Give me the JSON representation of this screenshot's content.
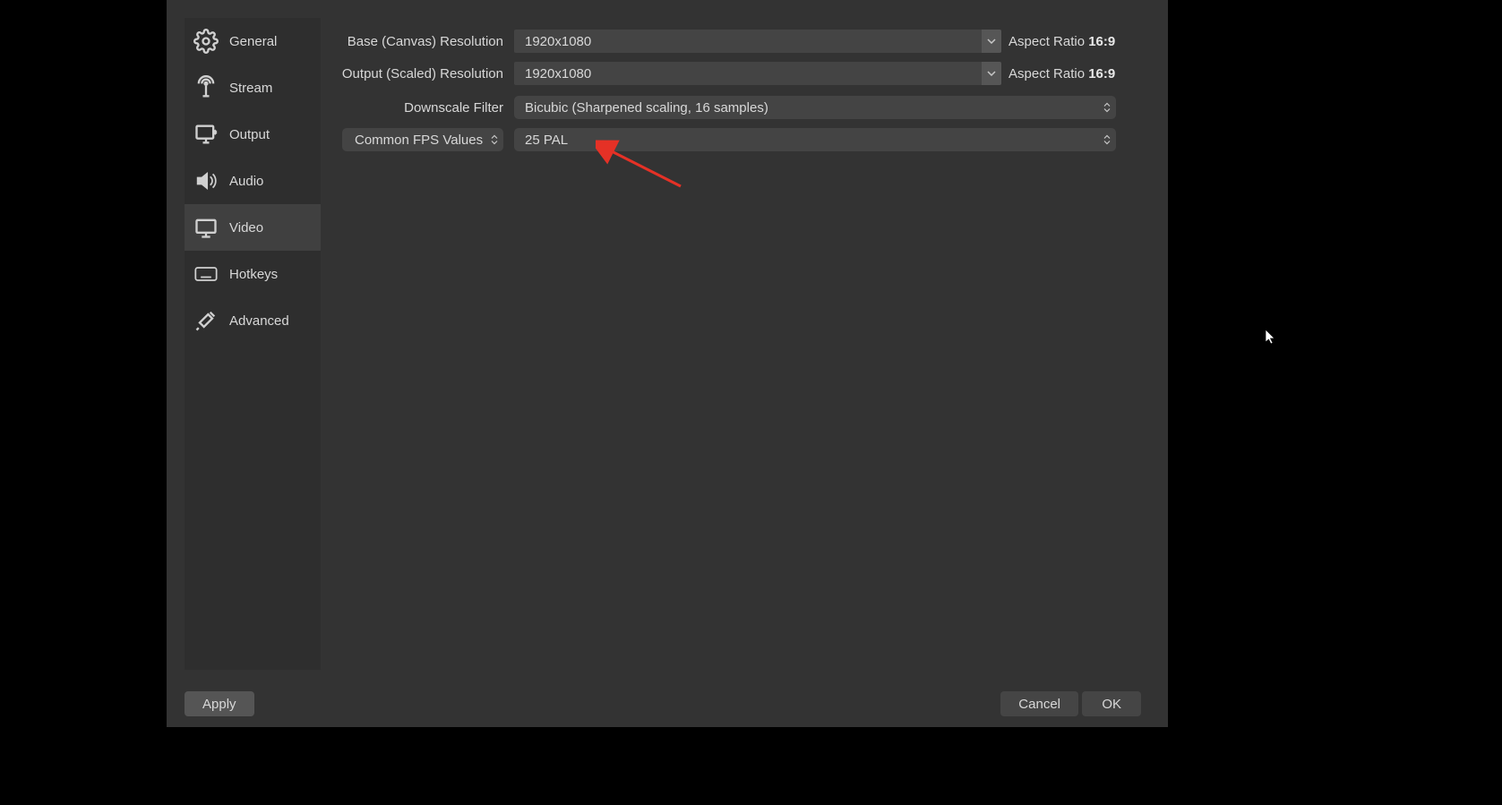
{
  "sidebar": {
    "items": [
      {
        "label": "General"
      },
      {
        "label": "Stream"
      },
      {
        "label": "Output"
      },
      {
        "label": "Audio"
      },
      {
        "label": "Video"
      },
      {
        "label": "Hotkeys"
      },
      {
        "label": "Advanced"
      }
    ],
    "active_index": 4
  },
  "video": {
    "base_label": "Base (Canvas) Resolution",
    "base_value": "1920x1080",
    "base_aspect_label": "Aspect Ratio",
    "base_aspect_value": "16:9",
    "output_label": "Output (Scaled) Resolution",
    "output_value": "1920x1080",
    "output_aspect_label": "Aspect Ratio",
    "output_aspect_value": "16:9",
    "downscale_label": "Downscale Filter",
    "downscale_value": "Bicubic (Sharpened scaling, 16 samples)",
    "fps_mode_label": "Common FPS Values",
    "fps_value": "25 PAL"
  },
  "buttons": {
    "apply": "Apply",
    "cancel": "Cancel",
    "ok": "OK"
  }
}
